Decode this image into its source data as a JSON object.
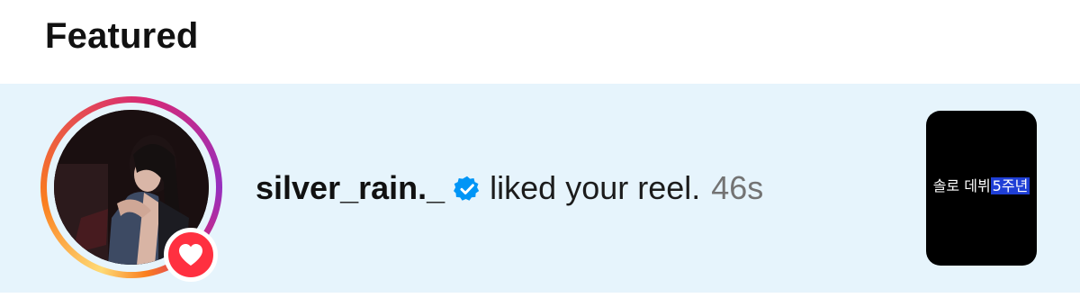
{
  "section": {
    "title": "Featured"
  },
  "notification": {
    "username": "silver_rain._",
    "verified": true,
    "action": "liked your reel.",
    "time": "46s",
    "badge_icon": "heart-icon",
    "thumbnail": {
      "text_plain": "솔로 데뷔",
      "text_highlight": "5주년"
    }
  },
  "colors": {
    "row_background": "#e6f4fc",
    "heart_badge": "#ff3040",
    "verified_badge": "#0095f6",
    "time_text": "#737373",
    "thumb_highlight": "#1f3fd6"
  }
}
